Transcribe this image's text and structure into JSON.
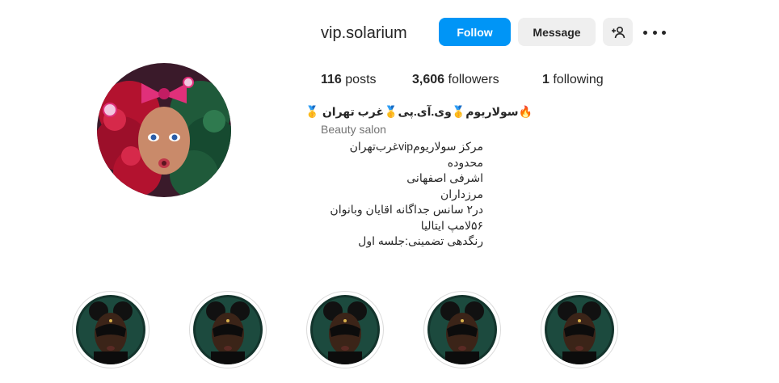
{
  "profile": {
    "username": "vip.solarium",
    "avatar_icon": "profile-avatar-illustration"
  },
  "actions": {
    "follow_label": "Follow",
    "message_label": "Message",
    "add_user_icon": "add-person-icon",
    "more_icon": "more-options-icon"
  },
  "stats": {
    "posts_count": "116",
    "posts_label": "posts",
    "followers_count": "3,606",
    "followers_label": "followers",
    "following_count": "1",
    "following_label": "following"
  },
  "bio": {
    "name": "🔥سولاریوم🥇وی.آی.پی🥇غرب تهران 🥇",
    "category": "Beauty salon",
    "lines": [
      "مرکز سولاریومvipغرب‌تهران",
      "محدوده",
      "اشرفی اصفهانی",
      "مرزداران",
      "در۲ سانس جداگانه اقایان وبانوان",
      "۵۶لامپ ایتالیا",
      "رنگدهی تضمینی:جلسه اول"
    ]
  },
  "highlights": [
    {
      "label": "",
      "icon": "story-highlight-cover"
    },
    {
      "label": "",
      "icon": "story-highlight-cover"
    },
    {
      "label": "",
      "icon": "story-highlight-cover"
    },
    {
      "label": "",
      "icon": "story-highlight-cover"
    },
    {
      "label": "",
      "icon": "story-highlight-cover"
    }
  ],
  "colors": {
    "follow_button": "#0095f6",
    "secondary_button": "#efefef",
    "text_primary": "#262626",
    "text_secondary": "#737373"
  }
}
